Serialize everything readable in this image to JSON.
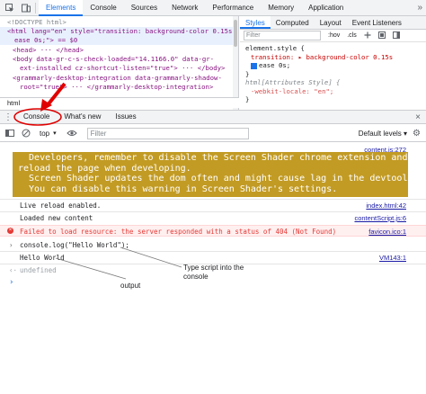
{
  "topbar": {
    "tabs": [
      "Elements",
      "Console",
      "Sources",
      "Network",
      "Performance",
      "Memory",
      "Application"
    ],
    "more": "»"
  },
  "elements": {
    "lines": [
      "<!DOCTYPE html>",
      "<html lang=\"en\" style=\"transition: background-color 0.15s",
      "ease 0s;\"> == $0",
      "<head> ··· </head>",
      "<body data-gr-c-s-check-loaded=\"14.1166.0\" data-gr-",
      "ext-installed cz-shortcut-listen=\"true\"> ··· </body>",
      "<grammarly-desktop-integration data-grammarly-shadow-",
      "root=\"true\"> ··· </grammarly-desktop-integration>"
    ],
    "breadcrumb": "html"
  },
  "styles": {
    "tabs": [
      "Styles",
      "Computed",
      "Layout",
      "Event Listeners"
    ],
    "filter_placeholder": "Filter",
    "hov": ":hov",
    "cls": ".cls",
    "lines": [
      "element.style {",
      "transition: ▸ background-color 0.15s",
      "ease 0s;",
      "}",
      "html[Attributes Style] {",
      "-webkit-locale: \"en\";",
      "}"
    ]
  },
  "drawer": {
    "tabs": [
      "Console",
      "What's new",
      "Issues"
    ],
    "close": "×"
  },
  "console_toolbar": {
    "context": "top",
    "filter_placeholder": "Filter",
    "levels": "Default levels ▾"
  },
  "console": {
    "banner_source": "content.js:272",
    "banner_lines": [
      "  Developers, remember to disable the Screen Shader chrome extension and",
      "reload the page when developing.",
      "  Screen Shader updates the dom often and might cause lag in the devtools!",
      "  You can disable this warning in Screen Shader's settings."
    ],
    "messages": [
      {
        "text": "Live reload enabled.",
        "source": "index.html:42"
      },
      {
        "text": "Loaded new content",
        "source": "contentScript.js:6"
      }
    ],
    "error": {
      "text": "Failed to load resource: the server responded with a status of 404 (Not Found)",
      "source": "favicon.ico:1"
    },
    "input_command": "console.log(\"Hello World\");",
    "output_text": "Hello World",
    "output_source": "VM143:1",
    "undefined_text": "undefined",
    "prompt": "›"
  },
  "annotations": {
    "type_script": "Type script into the\nconsole",
    "output": "output"
  },
  "colors": {
    "accent": "#1a73e8",
    "banner": "#c29b24",
    "error_red": "#e53935",
    "arrow_red": "#e00000"
  }
}
